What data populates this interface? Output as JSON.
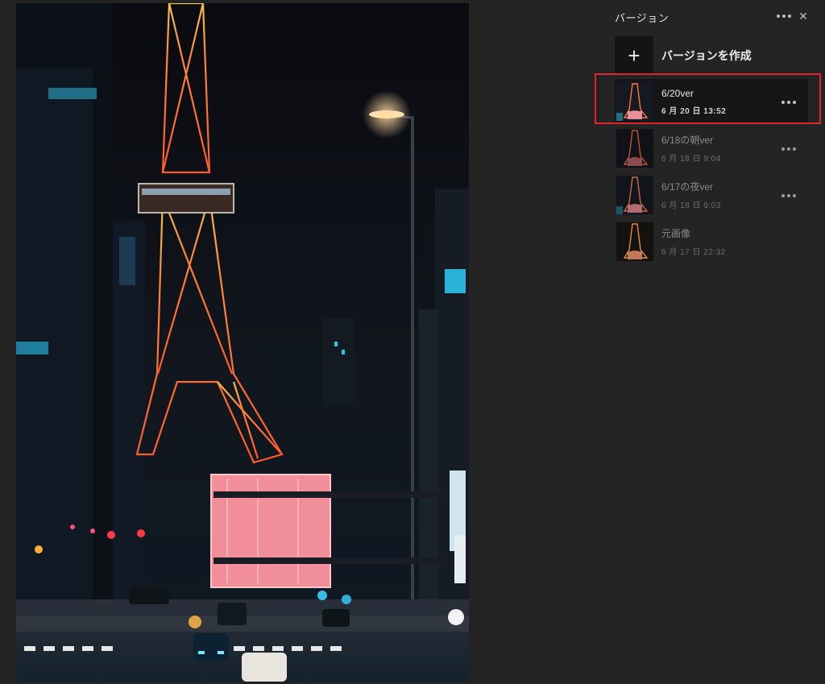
{
  "panel": {
    "title": "バージョン",
    "more_icon": "more-horizontal-icon",
    "close_icon": "close-icon",
    "close_glyph": "✕"
  },
  "create": {
    "icon": "plus-icon",
    "plus_glyph": "+",
    "label": "バージョンを作成"
  },
  "versions": [
    {
      "name": "6/20ver",
      "date": "6 月 20 日 13:52",
      "active": true
    },
    {
      "name": "6/18の朝ver",
      "date": "6 月 18 日 9:04",
      "active": false
    },
    {
      "name": "6/17の夜ver",
      "date": "6 月 18 日 9:03",
      "active": false
    },
    {
      "name": "元画像",
      "date": "6 月 17 日 22:32",
      "active": false
    }
  ],
  "colors": {
    "highlight": "#e0262b",
    "tower_orange": "#ff7a3a",
    "tower_gold": "#f2c45a",
    "city_cyan": "#27b3d9"
  }
}
